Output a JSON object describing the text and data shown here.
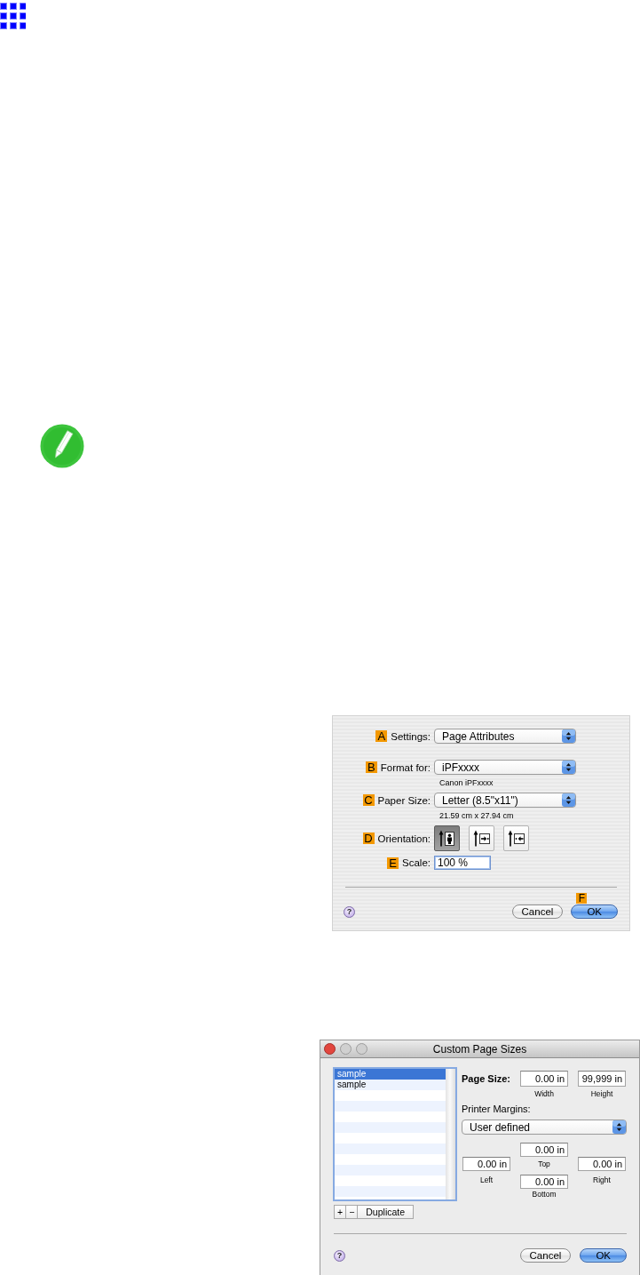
{
  "page_attributes_dialog": {
    "rows": [
      {
        "kind": "popup",
        "marker": "A",
        "label": "Settings:",
        "value": "Page Attributes"
      },
      {
        "kind": "popup",
        "marker": "B",
        "label": "Format for:",
        "value": "iPFxxxx",
        "note": "Canon iPFxxxx"
      },
      {
        "kind": "popup",
        "marker": "C",
        "label": "Paper Size:",
        "value": "Letter (8.5\"x11\")",
        "note": "21.59 cm x 27.94 cm"
      },
      {
        "kind": "orientation",
        "marker": "D",
        "label": "Orientation:",
        "options": [
          {
            "selected": true
          },
          {
            "selected": false
          },
          {
            "selected": false
          }
        ]
      },
      {
        "kind": "field",
        "marker": "E",
        "label": "Scale:",
        "value": "100 %"
      }
    ],
    "help": "?",
    "buttons": [
      {
        "label": "Cancel",
        "default": false
      },
      {
        "label": "OK",
        "default": true,
        "marker": "F"
      }
    ]
  },
  "custom_page_sizes_dialog": {
    "title": "Custom Page Sizes",
    "list": [
      {
        "label": "sample",
        "selected": true
      },
      {
        "label": "sample",
        "selected": false
      }
    ],
    "list_buttons": [
      "+",
      "−",
      "Duplicate"
    ],
    "page_size": {
      "label": "Page Size:",
      "width": {
        "value": "0.00 in",
        "caption": "Width"
      },
      "height": {
        "value": "99,999 in",
        "caption": "Height"
      }
    },
    "printer_margins": {
      "label": "Printer Margins:",
      "value": "User defined",
      "top": {
        "value": "0.00 in",
        "caption": "Top"
      },
      "left": {
        "value": "0.00 in",
        "caption": "Left"
      },
      "right": {
        "value": "0.00 in",
        "caption": "Right"
      },
      "bottom": {
        "value": "0.00 in",
        "caption": "Bottom"
      }
    },
    "help": "?",
    "buttons": [
      {
        "label": "Cancel",
        "default": false
      },
      {
        "label": "OK",
        "default": true
      }
    ]
  }
}
